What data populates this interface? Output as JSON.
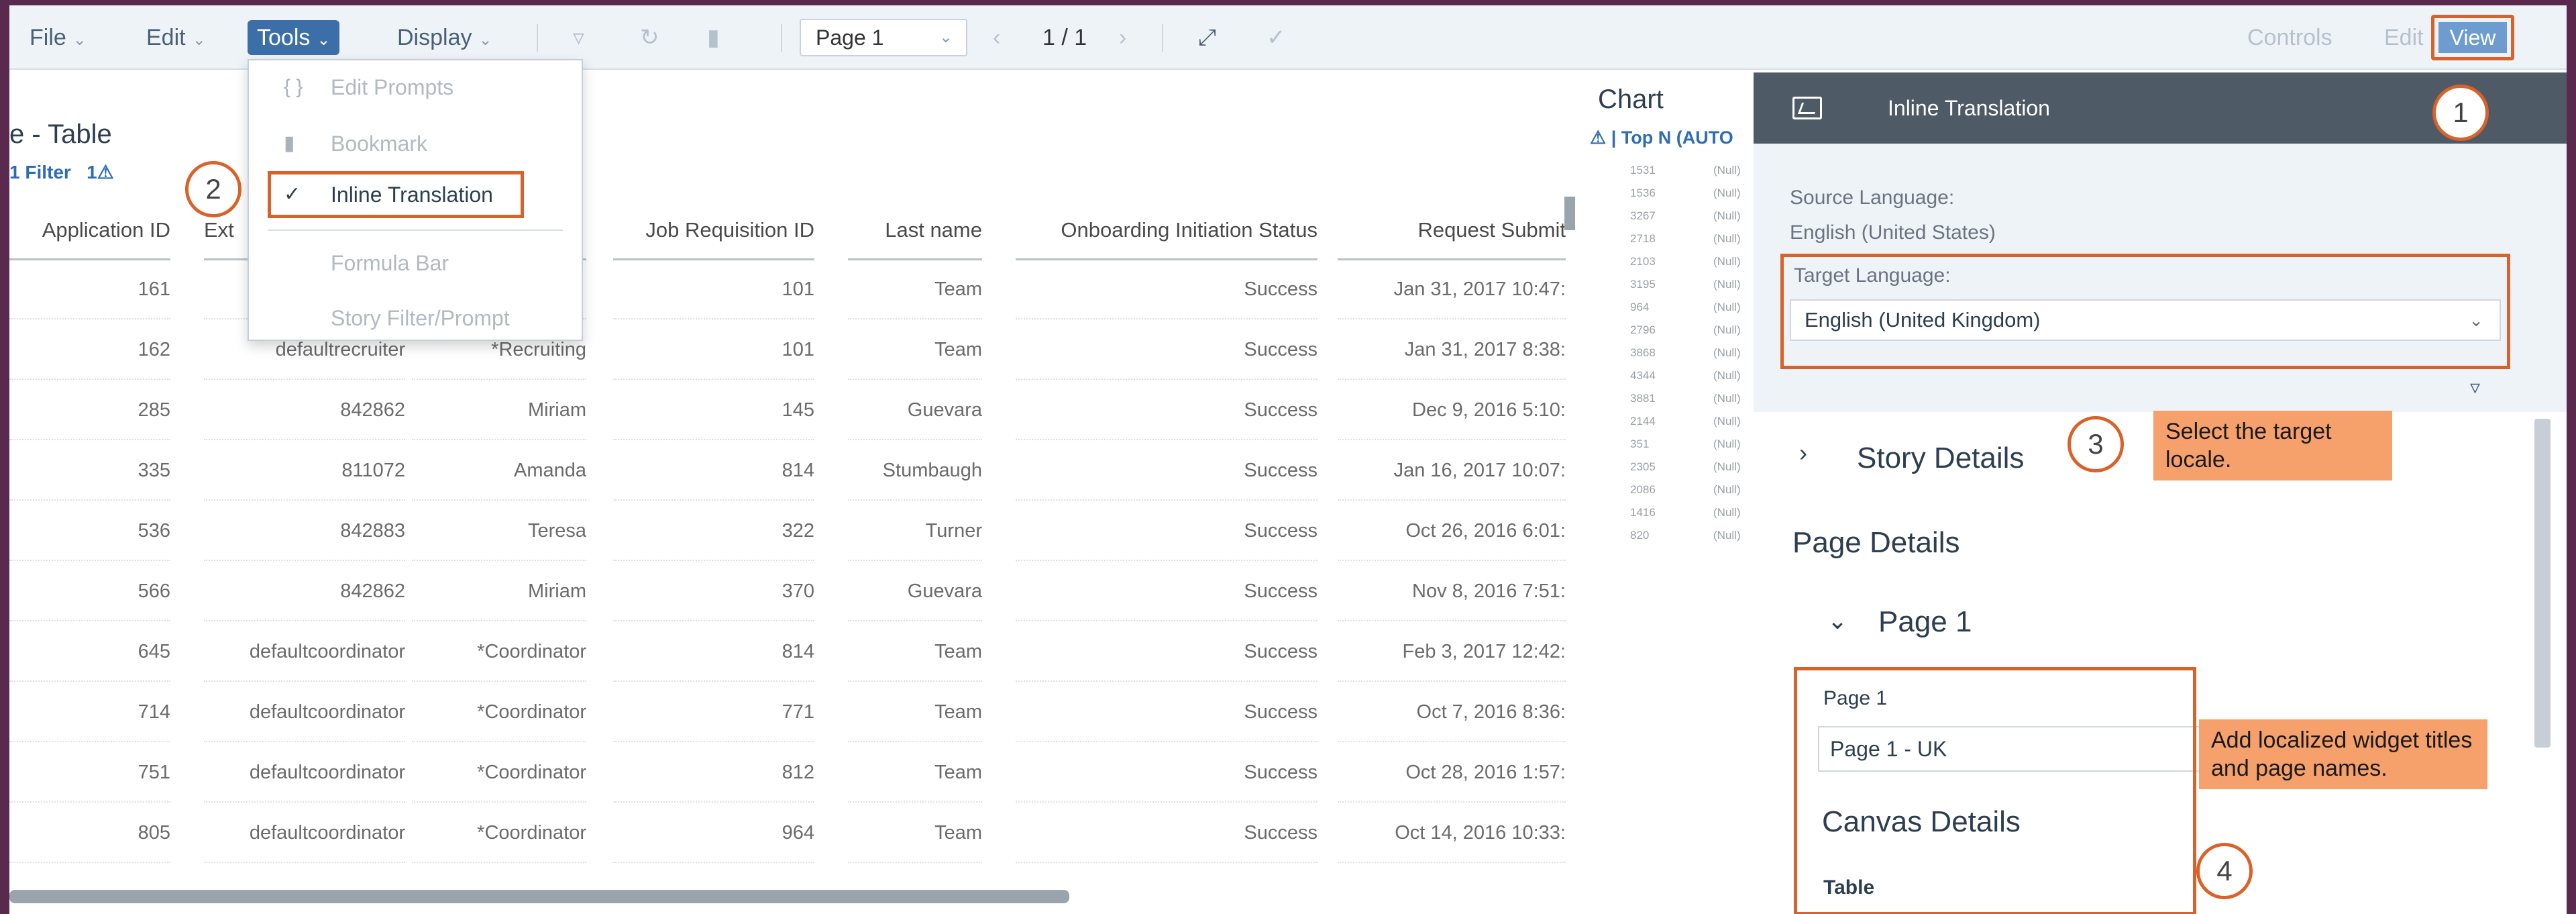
{
  "toolbar": {
    "file": "File",
    "edit": "Edit",
    "tools": "Tools",
    "display": "Display",
    "page_select": "Page 1",
    "page_count": "1 / 1",
    "controls": "Controls",
    "edit_mode": "Edit",
    "view_mode": "View"
  },
  "tools_menu": {
    "items": [
      {
        "label": "Edit Prompts",
        "icon": "braces-icon"
      },
      {
        "label": "Bookmark",
        "icon": "bookmark-icon"
      },
      {
        "label": "Inline Translation",
        "icon": "check-icon"
      },
      {
        "label": "Formula Bar",
        "icon": ""
      },
      {
        "label": "Story Filter/Prompt",
        "icon": ""
      }
    ]
  },
  "report": {
    "title": "e - Table",
    "filter": "1 Filter",
    "filter_extra": "1",
    "columns": [
      "Application ID",
      "Ext",
      "",
      "Job Requisition ID",
      "Last name",
      "Onboarding Initiation Status",
      "Request Submit"
    ],
    "rows": [
      [
        "161",
        "",
        "",
        "101",
        "Team",
        "Success",
        "Jan 31, 2017 10:47:"
      ],
      [
        "162",
        "defaultrecruiter",
        "*Recruiting",
        "101",
        "Team",
        "Success",
        "Jan 31, 2017 8:38:"
      ],
      [
        "285",
        "842862",
        "Miriam",
        "145",
        "Guevara",
        "Success",
        "Dec 9, 2016 5:10:"
      ],
      [
        "335",
        "811072",
        "Amanda",
        "814",
        "Stumbaugh",
        "Success",
        "Jan 16, 2017 10:07:"
      ],
      [
        "536",
        "842883",
        "Teresa",
        "322",
        "Turner",
        "Success",
        "Oct 26, 2016 6:01:"
      ],
      [
        "566",
        "842862",
        "Miriam",
        "370",
        "Guevara",
        "Success",
        "Nov 8, 2016 7:51:"
      ],
      [
        "645",
        "defaultcoordinator",
        "*Coordinator",
        "814",
        "Team",
        "Success",
        "Feb 3, 2017 12:42:"
      ],
      [
        "714",
        "defaultcoordinator",
        "*Coordinator",
        "771",
        "Team",
        "Success",
        "Oct 7, 2016 8:36:"
      ],
      [
        "751",
        "defaultcoordinator",
        "*Coordinator",
        "812",
        "Team",
        "Success",
        "Oct 28, 2016 1:57:"
      ],
      [
        "805",
        "defaultcoordinator",
        "*Coordinator",
        "964",
        "Team",
        "Success",
        "Oct 14, 2016 10:33:"
      ]
    ]
  },
  "chart": {
    "title": "Chart",
    "topn": "Top N (AUTO",
    "values": [
      "1531",
      "1536",
      "3267",
      "2718",
      "2103",
      "3195",
      "964",
      "2796",
      "3868",
      "4344",
      "3881",
      "2144",
      "351",
      "2305",
      "2086",
      "1416",
      "820"
    ],
    "null_label": "(Null)"
  },
  "panel": {
    "title": "Inline Translation",
    "source_label": "Source Language:",
    "source_value": "English (United States)",
    "target_label": "Target Language:",
    "target_value": "English (United Kingdom)",
    "story_details": "Story Details",
    "page_details": "Page Details",
    "page_section": "Page 1",
    "page_field_label": "Page 1",
    "page_field_value": "Page 1 - UK",
    "canvas_details": "Canvas Details",
    "table_label": "Table"
  },
  "callouts": {
    "n1": "1",
    "n2": "2",
    "n3": "3",
    "n4": "4",
    "note3": "Select the target locale.",
    "note4": "Add localized widget titles and page names."
  },
  "colors": {
    "accent": "#3c6fa8",
    "highlight": "#d9622b",
    "note_bg": "#f6a06b",
    "panel_header": "#4e5a66"
  }
}
